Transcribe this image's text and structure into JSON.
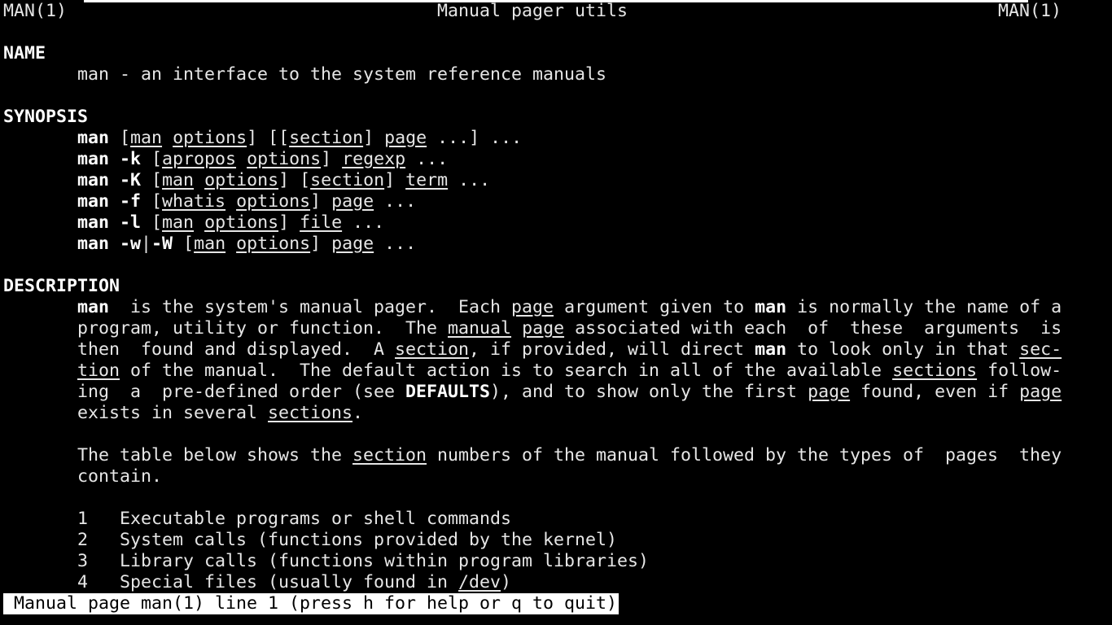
{
  "header": {
    "left": "MAN(1)",
    "center": "Manual pager utils",
    "right": "MAN(1)"
  },
  "name_section": {
    "heading": "NAME",
    "text": "man - an interface to the system reference manuals"
  },
  "synopsis": {
    "heading": "SYNOPSIS",
    "lines": [
      [
        {
          "t": "man",
          "s": "b"
        },
        {
          "t": " ["
        },
        {
          "t": "man",
          "s": "u"
        },
        {
          "t": " "
        },
        {
          "t": "options",
          "s": "u"
        },
        {
          "t": "] [["
        },
        {
          "t": "section",
          "s": "u"
        },
        {
          "t": "] "
        },
        {
          "t": "page",
          "s": "u"
        },
        {
          "t": " ...] ..."
        }
      ],
      [
        {
          "t": "man -k",
          "s": "b"
        },
        {
          "t": " ["
        },
        {
          "t": "apropos",
          "s": "u"
        },
        {
          "t": " "
        },
        {
          "t": "options",
          "s": "u"
        },
        {
          "t": "] "
        },
        {
          "t": "regexp",
          "s": "u"
        },
        {
          "t": " ..."
        }
      ],
      [
        {
          "t": "man -K",
          "s": "b"
        },
        {
          "t": " ["
        },
        {
          "t": "man",
          "s": "u"
        },
        {
          "t": " "
        },
        {
          "t": "options",
          "s": "u"
        },
        {
          "t": "] ["
        },
        {
          "t": "section",
          "s": "u"
        },
        {
          "t": "] "
        },
        {
          "t": "term",
          "s": "u"
        },
        {
          "t": " ..."
        }
      ],
      [
        {
          "t": "man -f",
          "s": "b"
        },
        {
          "t": " ["
        },
        {
          "t": "whatis",
          "s": "u"
        },
        {
          "t": " "
        },
        {
          "t": "options",
          "s": "u"
        },
        {
          "t": "] "
        },
        {
          "t": "page",
          "s": "u"
        },
        {
          "t": " ..."
        }
      ],
      [
        {
          "t": "man -l",
          "s": "b"
        },
        {
          "t": " ["
        },
        {
          "t": "man",
          "s": "u"
        },
        {
          "t": " "
        },
        {
          "t": "options",
          "s": "u"
        },
        {
          "t": "] "
        },
        {
          "t": "file",
          "s": "u"
        },
        {
          "t": " ..."
        }
      ],
      [
        {
          "t": "man -w",
          "s": "b"
        },
        {
          "t": "|"
        },
        {
          "t": "-W",
          "s": "b"
        },
        {
          "t": " ["
        },
        {
          "t": "man",
          "s": "u"
        },
        {
          "t": " "
        },
        {
          "t": "options",
          "s": "u"
        },
        {
          "t": "] "
        },
        {
          "t": "page",
          "s": "u"
        },
        {
          "t": " ..."
        }
      ]
    ]
  },
  "description": {
    "heading": "DESCRIPTION",
    "para1": [
      [
        {
          "t": "man",
          "s": "b"
        },
        {
          "t": "  is the system's manual pager.  Each "
        },
        {
          "t": "page",
          "s": "u"
        },
        {
          "t": " argument given to "
        },
        {
          "t": "man",
          "s": "b"
        },
        {
          "t": " is normally the name of a"
        }
      ],
      [
        {
          "t": "program, utility or function.  The "
        },
        {
          "t": "manual",
          "s": "u"
        },
        {
          "t": " "
        },
        {
          "t": "page",
          "s": "u"
        },
        {
          "t": " associated with each  of  these  arguments  is"
        }
      ],
      [
        {
          "t": "then  found and displayed.  A "
        },
        {
          "t": "section",
          "s": "u"
        },
        {
          "t": ", if provided, will direct "
        },
        {
          "t": "man",
          "s": "b"
        },
        {
          "t": " to look only in that "
        },
        {
          "t": "sec-",
          "s": "u"
        }
      ],
      [
        {
          "t": "tion",
          "s": "u"
        },
        {
          "t": " of the manual.  The default action is to search in all of the available "
        },
        {
          "t": "sections",
          "s": "u"
        },
        {
          "t": " follow-"
        }
      ],
      [
        {
          "t": "ing  a  pre-defined order (see "
        },
        {
          "t": "DEFAULTS",
          "s": "b"
        },
        {
          "t": "), and to show only the first "
        },
        {
          "t": "page",
          "s": "u"
        },
        {
          "t": " found, even if "
        },
        {
          "t": "page",
          "s": "u"
        }
      ],
      [
        {
          "t": "exists in several "
        },
        {
          "t": "sections",
          "s": "u"
        },
        {
          "t": "."
        }
      ]
    ],
    "para2": [
      [
        {
          "t": "The table below shows the "
        },
        {
          "t": "section",
          "s": "u"
        },
        {
          "t": " numbers of the manual followed by the types of  pages  they"
        }
      ],
      [
        {
          "t": "contain."
        }
      ]
    ],
    "table": [
      [
        {
          "t": "1   Executable programs or shell commands"
        }
      ],
      [
        {
          "t": "2   System calls (functions provided by the kernel)"
        }
      ],
      [
        {
          "t": "3   Library calls (functions within program libraries)"
        }
      ],
      [
        {
          "t": "4   Special files (usually found in "
        },
        {
          "t": "/dev",
          "s": "u"
        },
        {
          "t": ")"
        }
      ]
    ]
  },
  "status_bar": {
    "text": " Manual page man(1) line 1 (press h for help or q to quit)"
  },
  "colors": {
    "background": "#000000",
    "foreground": "#e6e6e6",
    "status_bg": "#ffffff",
    "status_fg": "#000000"
  }
}
